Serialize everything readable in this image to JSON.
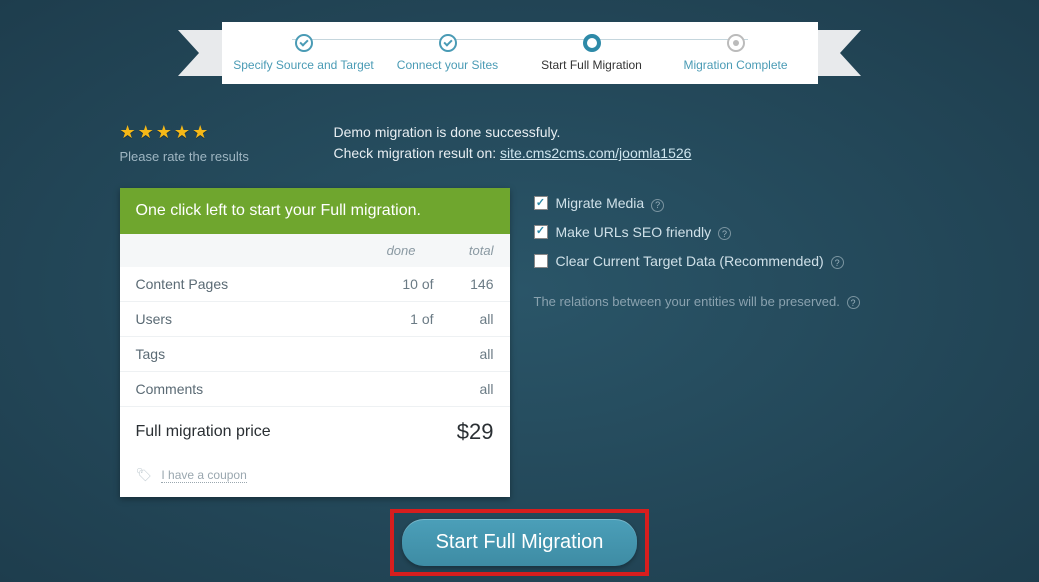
{
  "stepper": {
    "steps": [
      {
        "label": "Specify Source and Target",
        "state": "done"
      },
      {
        "label": "Connect your Sites",
        "state": "done"
      },
      {
        "label": "Start Full Migration",
        "state": "current"
      },
      {
        "label": "Migration Complete",
        "state": "future"
      }
    ]
  },
  "rating": {
    "prompt": "Please rate the results"
  },
  "status": {
    "line1": "Demo migration is done successfuly.",
    "line2_prefix": "Check migration result on: ",
    "link_text": "site.cms2cms.com/joomla1526"
  },
  "panel": {
    "title": "One click left to start your Full migration.",
    "head_done": "done",
    "head_total": "total",
    "rows": [
      {
        "label": "Content Pages",
        "done": "10 of",
        "total": "146"
      },
      {
        "label": "Users",
        "done": "1 of",
        "total": "all"
      },
      {
        "label": "Tags",
        "done": "",
        "total": "all"
      },
      {
        "label": "Comments",
        "done": "",
        "total": "all"
      }
    ],
    "footer_label": "Full migration price",
    "footer_price": "$29",
    "coupon_text": "I have a coupon"
  },
  "options": {
    "items": [
      {
        "label": "Migrate Media",
        "checked": true,
        "help": true
      },
      {
        "label": "Make URLs SEO friendly",
        "checked": true,
        "help": true
      },
      {
        "label": "Clear Current Target Data (Recommended)",
        "checked": false,
        "help": true
      }
    ],
    "note": "The relations between your entities will be preserved."
  },
  "cta": {
    "label": "Start Full Migration"
  }
}
